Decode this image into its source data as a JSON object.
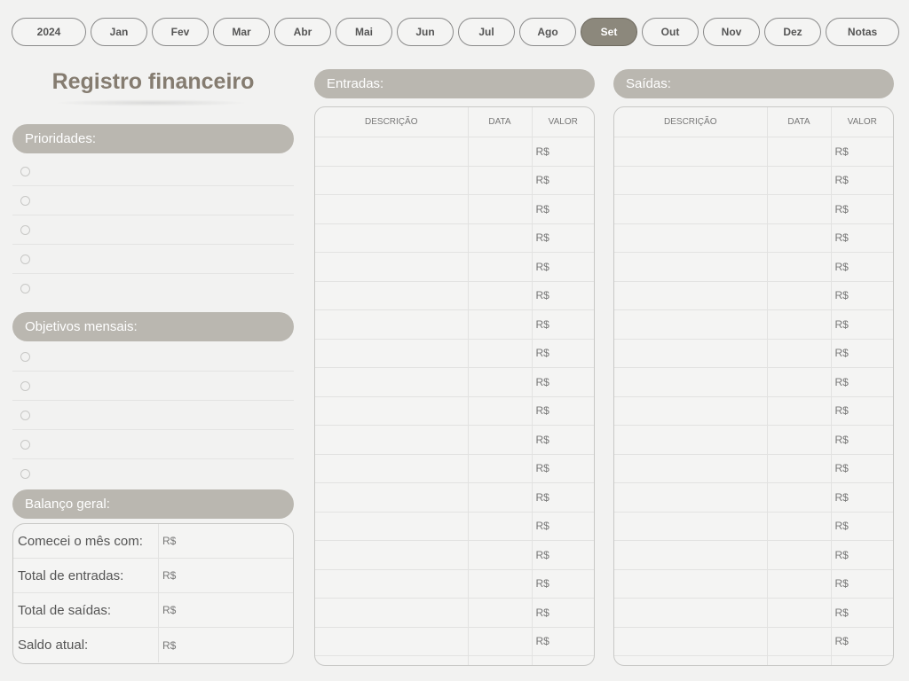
{
  "tabs": [
    {
      "label": "2024",
      "active": false
    },
    {
      "label": "Jan",
      "active": false
    },
    {
      "label": "Fev",
      "active": false
    },
    {
      "label": "Mar",
      "active": false
    },
    {
      "label": "Abr",
      "active": false
    },
    {
      "label": "Mai",
      "active": false
    },
    {
      "label": "Jun",
      "active": false
    },
    {
      "label": "Jul",
      "active": false
    },
    {
      "label": "Ago",
      "active": false
    },
    {
      "label": "Set",
      "active": true
    },
    {
      "label": "Out",
      "active": false
    },
    {
      "label": "Nov",
      "active": false
    },
    {
      "label": "Dez",
      "active": false
    },
    {
      "label": "Notas",
      "active": false
    }
  ],
  "title": "Registro financeiro",
  "priorities": {
    "header": "Prioridades:",
    "count": 5
  },
  "objectives": {
    "header": "Objetivos mensais:",
    "count": 5
  },
  "balance": {
    "header": "Balanço geral:",
    "rows": [
      {
        "label": "Comecei o mês com:",
        "value": "R$"
      },
      {
        "label": "Total de entradas:",
        "value": "R$"
      },
      {
        "label": "Total de saídas:",
        "value": "R$"
      },
      {
        "label": "Saldo atual:",
        "value": "R$"
      }
    ]
  },
  "income": {
    "header": "Entradas:",
    "columns": [
      "DESCRIÇÃO",
      "DATA",
      "VALOR"
    ],
    "rows": 19,
    "currency": "R$"
  },
  "expenses": {
    "header": "Saídas:",
    "columns": [
      "DESCRIÇÃO",
      "DATA",
      "VALOR"
    ],
    "rows": 19,
    "currency": "R$"
  },
  "colors": {
    "accent": "#8c887c",
    "pill": "#bab7b0",
    "title": "#857c70"
  }
}
